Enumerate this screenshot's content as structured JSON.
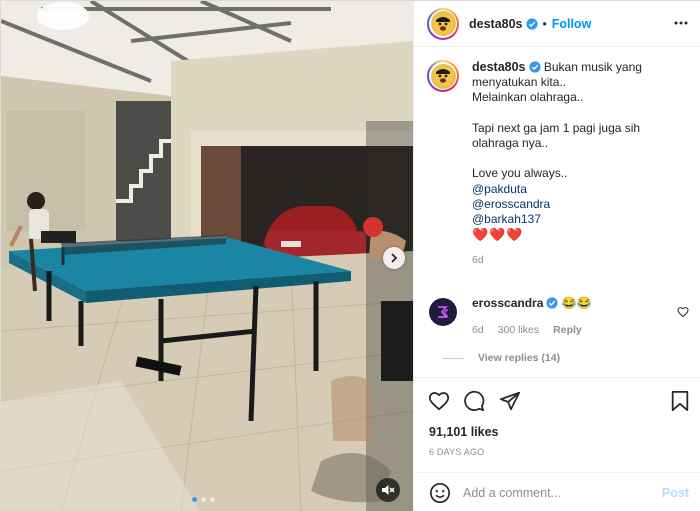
{
  "post": {
    "username": "desta80s",
    "follow_label": "Follow",
    "separator": "•",
    "avatar_icon": "profile-photo",
    "verified_icon": "verified-badge-icon",
    "more_icon": "more-options-icon"
  },
  "media": {
    "alt_scene": "table-tennis-video",
    "carousel_count": 3,
    "carousel_active": 1,
    "next_icon": "chevron-right-icon",
    "mute_icon": "audio-muted-icon"
  },
  "caption": {
    "username": "desta80s",
    "lines": [
      "Bukan musik yang",
      "menyatukan kita..",
      "Melainkan olahraga..",
      "",
      "Tapi next ga jam 1 pagi juga sih",
      "olahraga nya..",
      "",
      "Love you always.."
    ],
    "mentions": [
      "@pakduta",
      "@erosscandra",
      "@barkah137"
    ],
    "hearts": "❤️❤️❤️",
    "time": "6d"
  },
  "comment": {
    "username": "erosscandra",
    "text": "😂😂",
    "time": "6d",
    "likes": "300 likes",
    "reply_label": "Reply",
    "view_replies": "View replies (14)",
    "like_icon": "heart-outline-icon"
  },
  "actions": {
    "like_icon": "heart-outline-icon",
    "comment_icon": "comment-icon",
    "share_icon": "share-icon",
    "save_icon": "bookmark-icon"
  },
  "likes_count": "91,101 likes",
  "date_label": "6 DAYS AGO",
  "add_comment": {
    "placeholder": "Add a comment...",
    "post_label": "Post",
    "emoji_icon": "emoji-icon"
  },
  "colors": {
    "accent": "#0095f6",
    "post_disabled": "#b2dffc",
    "heart": "#ed4956",
    "table": "#1b86a3"
  }
}
